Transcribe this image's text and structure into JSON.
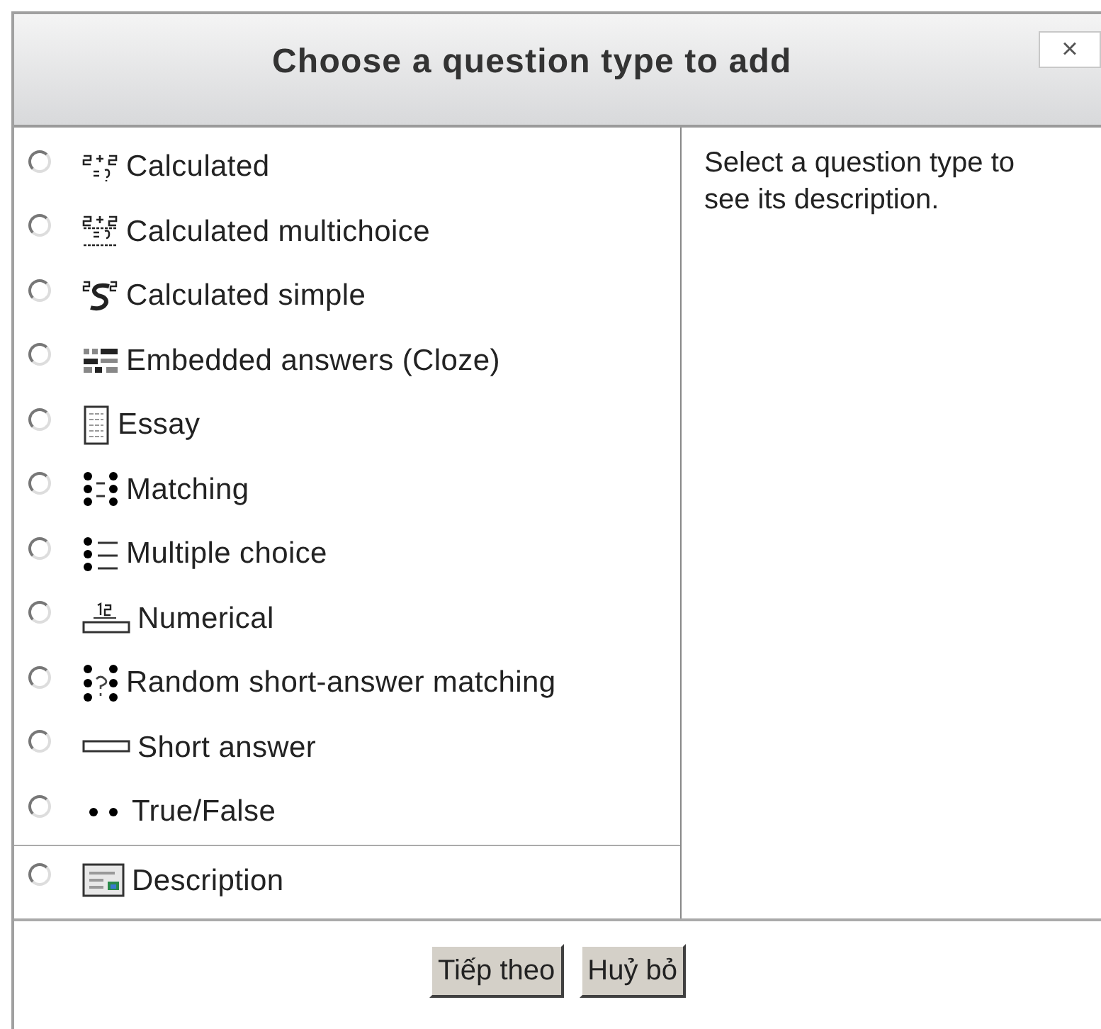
{
  "dialog": {
    "title": "Choose a question type to add",
    "close_label": "×"
  },
  "question_types": [
    {
      "label": "Calculated",
      "selected": false
    },
    {
      "label": "Calculated multichoice",
      "selected": false
    },
    {
      "label": "Calculated simple",
      "selected": false
    },
    {
      "label": "Embedded answers (Cloze)",
      "selected": false
    },
    {
      "label": "Essay",
      "selected": false
    },
    {
      "label": "Matching",
      "selected": false
    },
    {
      "label": "Multiple choice",
      "selected": false
    },
    {
      "label": "Numerical",
      "selected": false
    },
    {
      "label": "Random short-answer matching",
      "selected": false
    },
    {
      "label": "Short answer",
      "selected": false
    },
    {
      "label": "True/False",
      "selected": false
    }
  ],
  "other_types": [
    {
      "label": "Description",
      "selected": false
    }
  ],
  "description_text": "Select a question type to see its description.",
  "buttons": [
    "Tiếp theo",
    "Huỷ bỏ"
  ]
}
